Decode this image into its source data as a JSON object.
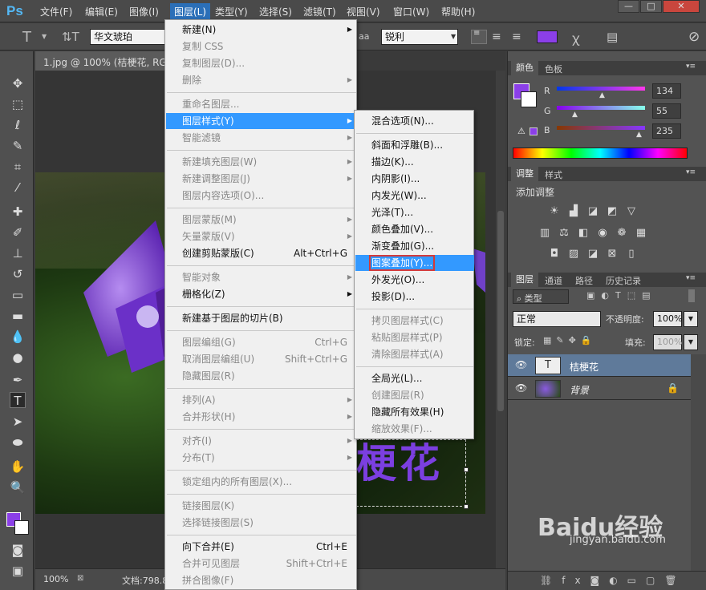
{
  "app_logo": "Ps",
  "menubar": [
    {
      "label": "文件(F)"
    },
    {
      "label": "编辑(E)"
    },
    {
      "label": "图像(I)"
    },
    {
      "label": "图层(L)",
      "active": true
    },
    {
      "label": "类型(Y)"
    },
    {
      "label": "选择(S)"
    },
    {
      "label": "滤镜(T)"
    },
    {
      "label": "视图(V)"
    },
    {
      "label": "窗口(W)"
    },
    {
      "label": "帮助(H)"
    }
  ],
  "window_buttons": {
    "minimize": "—",
    "restore": "□",
    "close": "✕"
  },
  "options": {
    "font_family": "华文琥珀",
    "antialias_icon": "aa",
    "antialias_value": "锐利",
    "text_color": "#8b3fe8"
  },
  "document": {
    "tab_title": "1.jpg @ 100% (桔梗花, RGB/",
    "zoom": "100%",
    "doc_info": "文档:798.8"
  },
  "colors": {
    "foreground": "#8b3fe8",
    "panel_tabs": [
      "颜色",
      "色板"
    ],
    "r_label": "R",
    "g_label": "G",
    "b_label": "B",
    "r": "134",
    "g": "55",
    "b": "235"
  },
  "adjustments": {
    "tabs": [
      "调整",
      "样式"
    ],
    "title": "添加调整"
  },
  "layers_panel": {
    "tabs": [
      "图层",
      "通道",
      "路径",
      "历史记录"
    ],
    "filter": "类型",
    "blend_mode": "正常",
    "opacity_label": "不透明度:",
    "opacity": "100%",
    "lock_label": "锁定:",
    "fill_label": "填充:",
    "fill": "100%",
    "layers": [
      {
        "name": "桔梗花",
        "type": "text",
        "selected": true
      },
      {
        "name": "背景",
        "type": "image",
        "locked": true
      }
    ]
  },
  "layer_menu": [
    {
      "label": "新建(N)",
      "sub": true
    },
    {
      "label": "复制 CSS",
      "disabled": true
    },
    {
      "label": "复制图层(D)...",
      "disabled": true
    },
    {
      "label": "删除",
      "disabled": true,
      "sub": true
    },
    {
      "sep": true
    },
    {
      "label": "重命名图层...",
      "disabled": true
    },
    {
      "label": "图层样式(Y)",
      "sub": true,
      "highlight": true
    },
    {
      "label": "智能滤镜",
      "disabled": true,
      "sub": true
    },
    {
      "sep": true
    },
    {
      "label": "新建填充图层(W)",
      "disabled": true,
      "sub": true
    },
    {
      "label": "新建调整图层(J)",
      "disabled": true,
      "sub": true
    },
    {
      "label": "图层内容选项(O)...",
      "disabled": true
    },
    {
      "sep": true
    },
    {
      "label": "图层蒙版(M)",
      "disabled": true,
      "sub": true
    },
    {
      "label": "矢量蒙版(V)",
      "disabled": true,
      "sub": true
    },
    {
      "label": "创建剪贴蒙版(C)",
      "shortcut": "Alt+Ctrl+G"
    },
    {
      "sep": true
    },
    {
      "label": "智能对象",
      "disabled": true,
      "sub": true
    },
    {
      "label": "栅格化(Z)",
      "sub": true
    },
    {
      "sep": true
    },
    {
      "label": "新建基于图层的切片(B)"
    },
    {
      "sep": true
    },
    {
      "label": "图层编组(G)",
      "disabled": true,
      "shortcut": "Ctrl+G"
    },
    {
      "label": "取消图层编组(U)",
      "disabled": true,
      "shortcut": "Shift+Ctrl+G"
    },
    {
      "label": "隐藏图层(R)",
      "disabled": true
    },
    {
      "sep": true
    },
    {
      "label": "排列(A)",
      "disabled": true,
      "sub": true
    },
    {
      "label": "合并形状(H)",
      "disabled": true,
      "sub": true
    },
    {
      "sep": true
    },
    {
      "label": "对齐(I)",
      "disabled": true,
      "sub": true
    },
    {
      "label": "分布(T)",
      "disabled": true,
      "sub": true
    },
    {
      "sep": true
    },
    {
      "label": "锁定组内的所有图层(X)...",
      "disabled": true
    },
    {
      "sep": true
    },
    {
      "label": "链接图层(K)",
      "disabled": true
    },
    {
      "label": "选择链接图层(S)",
      "disabled": true
    },
    {
      "sep": true
    },
    {
      "label": "向下合并(E)",
      "shortcut": "Ctrl+E"
    },
    {
      "label": "合并可见图层",
      "disabled": true,
      "shortcut": "Shift+Ctrl+E"
    },
    {
      "label": "拼合图像(F)",
      "disabled": true
    }
  ],
  "style_submenu": [
    {
      "label": "混合选项(N)..."
    },
    {
      "sep": true
    },
    {
      "label": "斜面和浮雕(B)..."
    },
    {
      "label": "描边(K)..."
    },
    {
      "label": "内阴影(I)..."
    },
    {
      "label": "内发光(W)..."
    },
    {
      "label": "光泽(T)..."
    },
    {
      "label": "颜色叠加(V)..."
    },
    {
      "label": "渐变叠加(G)..."
    },
    {
      "label": "图案叠加(Y)...",
      "highlight": true,
      "boxed": true
    },
    {
      "label": "外发光(O)..."
    },
    {
      "label": "投影(D)..."
    },
    {
      "sep": true
    },
    {
      "label": "拷贝图层样式(C)",
      "disabled": true
    },
    {
      "label": "粘贴图层样式(P)",
      "disabled": true
    },
    {
      "label": "清除图层样式(A)",
      "disabled": true
    },
    {
      "sep": true
    },
    {
      "label": "全局光(L)..."
    },
    {
      "label": "创建图层(R)",
      "disabled": true
    },
    {
      "label": "隐藏所有效果(H)"
    },
    {
      "label": "缩放效果(F)...",
      "disabled": true
    }
  ],
  "canvas_text": "梗花",
  "watermark": {
    "brand": "Baidu经验",
    "url": "jingyan.baidu.com"
  },
  "accent": "#3399ff"
}
